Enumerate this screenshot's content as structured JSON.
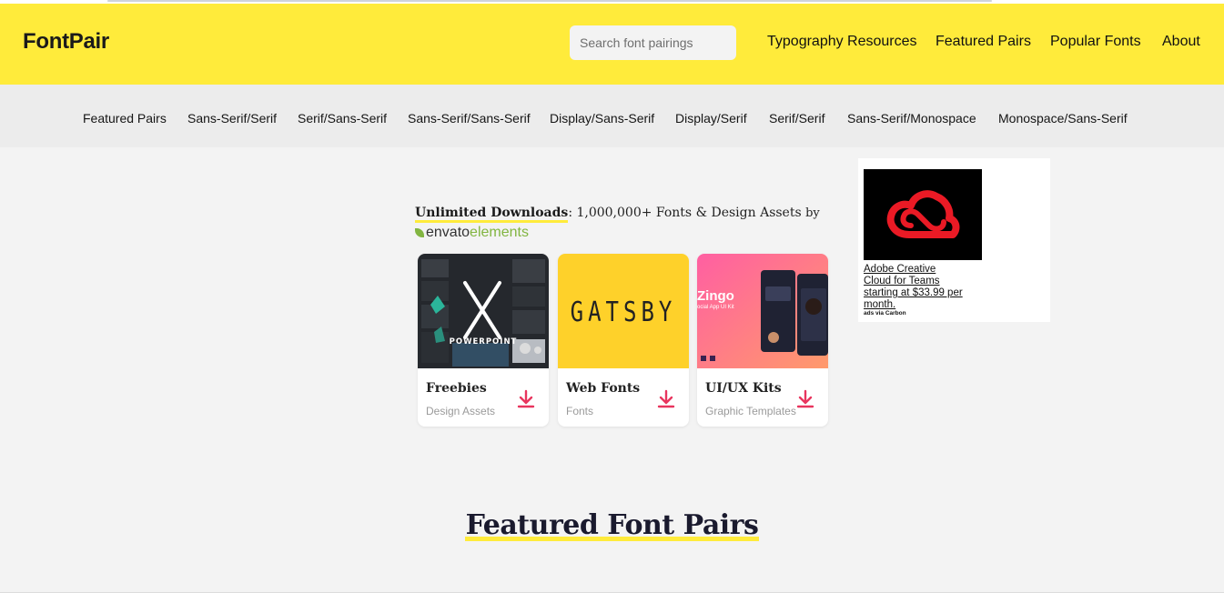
{
  "header": {
    "logo": "FontPair",
    "search_placeholder": "Search font pairings",
    "nav": [
      "Typography Resources",
      "Featured Pairs",
      "Popular Fonts",
      "About"
    ]
  },
  "subnav": [
    "Featured Pairs",
    "Sans-Serif/Serif",
    "Serif/Sans-Serif",
    "Sans-Serif/Sans-Serif",
    "Display/Sans-Serif",
    "Display/Serif",
    "Serif/Serif",
    "Sans-Serif/Monospace",
    "Monospace/Sans-Serif"
  ],
  "promo": {
    "headline_strong": "Unlimited Downloads",
    "headline_rest": ": 1,000,000+ Fonts & Design Assets",
    "by": "by",
    "envato_logo_a": "envato",
    "envato_logo_b": "elements",
    "cards": [
      {
        "title": "Freebies",
        "subtitle": "Design Assets",
        "thumb_text": "POWERPOINT",
        "thumb_icon": "x-letter-icon"
      },
      {
        "title": "Web Fonts",
        "subtitle": "Fonts",
        "thumb_text": "GATSBY"
      },
      {
        "title": "UI/UX Kits",
        "subtitle": "Graphic Templates",
        "thumb_text": "Zingo",
        "thumb_subtext": "ocial App UI Kit"
      }
    ]
  },
  "ad": {
    "text": "Adobe Creative Cloud for Teams starting at $33.99 per month.",
    "via": "ads via Carbon"
  },
  "featured_title": "Featured Font Pairs",
  "colors": {
    "brand_yellow": "#ffeb3b",
    "download_pink": "#e8355e",
    "envato_green": "#82b541"
  }
}
